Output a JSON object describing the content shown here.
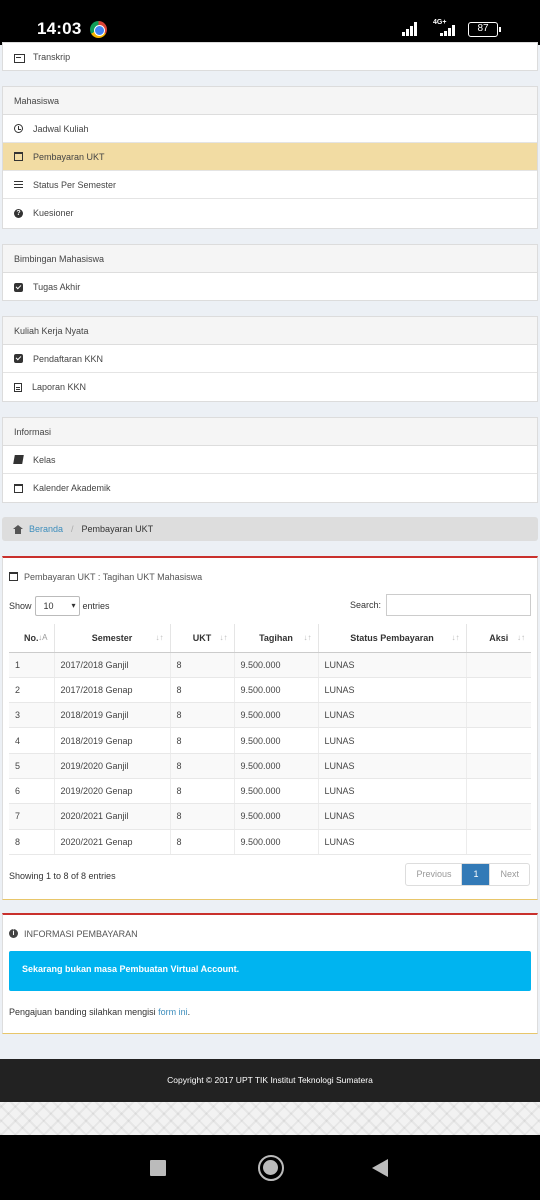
{
  "status_bar": {
    "time": "14:03",
    "network": "4G+",
    "battery": "87"
  },
  "menu": {
    "top_item": "Transkrip",
    "mahasiswa": {
      "header": "Mahasiswa",
      "items": [
        "Jadwal Kuliah",
        "Pembayaran UKT",
        "Status Per Semester",
        "Kuesioner"
      ]
    },
    "bimbingan": {
      "header": "Bimbingan Mahasiswa",
      "items": [
        "Tugas Akhir"
      ]
    },
    "kkn": {
      "header": "Kuliah Kerja Nyata",
      "items": [
        "Pendaftaran KKN",
        "Laporan KKN"
      ]
    },
    "informasi": {
      "header": "Informasi",
      "items": [
        "Kelas",
        "Kalender Akademik"
      ]
    }
  },
  "breadcrumb": {
    "home": "Beranda",
    "current": "Pembayaran UKT"
  },
  "payment_box": {
    "title": "Pembayaran UKT : Tagihan UKT Mahasiswa",
    "show_label": "Show",
    "entries_value": "10",
    "entries_label": "entries",
    "search_label": "Search:",
    "search_value": "",
    "columns": [
      "No.",
      "Semester",
      "UKT",
      "Tagihan",
      "Status Pembayaran",
      "Aksi"
    ],
    "rows": [
      [
        "1",
        "2017/2018 Ganjil",
        "8",
        "9.500.000",
        "LUNAS",
        ""
      ],
      [
        "2",
        "2017/2018 Genap",
        "8",
        "9.500.000",
        "LUNAS",
        ""
      ],
      [
        "3",
        "2018/2019 Ganjil",
        "8",
        "9.500.000",
        "LUNAS",
        ""
      ],
      [
        "4",
        "2018/2019 Genap",
        "8",
        "9.500.000",
        "LUNAS",
        ""
      ],
      [
        "5",
        "2019/2020 Ganjil",
        "8",
        "9.500.000",
        "LUNAS",
        ""
      ],
      [
        "6",
        "2019/2020 Genap",
        "8",
        "9.500.000",
        "LUNAS",
        ""
      ],
      [
        "7",
        "2020/2021 Ganjil",
        "8",
        "9.500.000",
        "LUNAS",
        ""
      ],
      [
        "8",
        "2020/2021 Genap",
        "8",
        "9.500.000",
        "LUNAS",
        ""
      ]
    ],
    "info": "Showing 1 to 8 of 8 entries",
    "pager": {
      "previous": "Previous",
      "page": "1",
      "next": "Next"
    }
  },
  "info_box": {
    "title": "INFORMASI PEMBAYARAN",
    "alert": "Sekarang bukan masa Pembuatan Virtual Account.",
    "note_prefix": "Pengajuan banding silahkan mengisi ",
    "note_link": "form ini",
    "note_suffix": "."
  },
  "footer": {
    "copyright": "Copyright © 2017 UPT TIK Institut Teknologi Sumatera"
  },
  "colors": {
    "active_menu": "#f2dca3",
    "alert": "#00b4f0",
    "box_top": "#c9302c",
    "link": "#3c8dbc",
    "page_active": "#337ab7"
  }
}
